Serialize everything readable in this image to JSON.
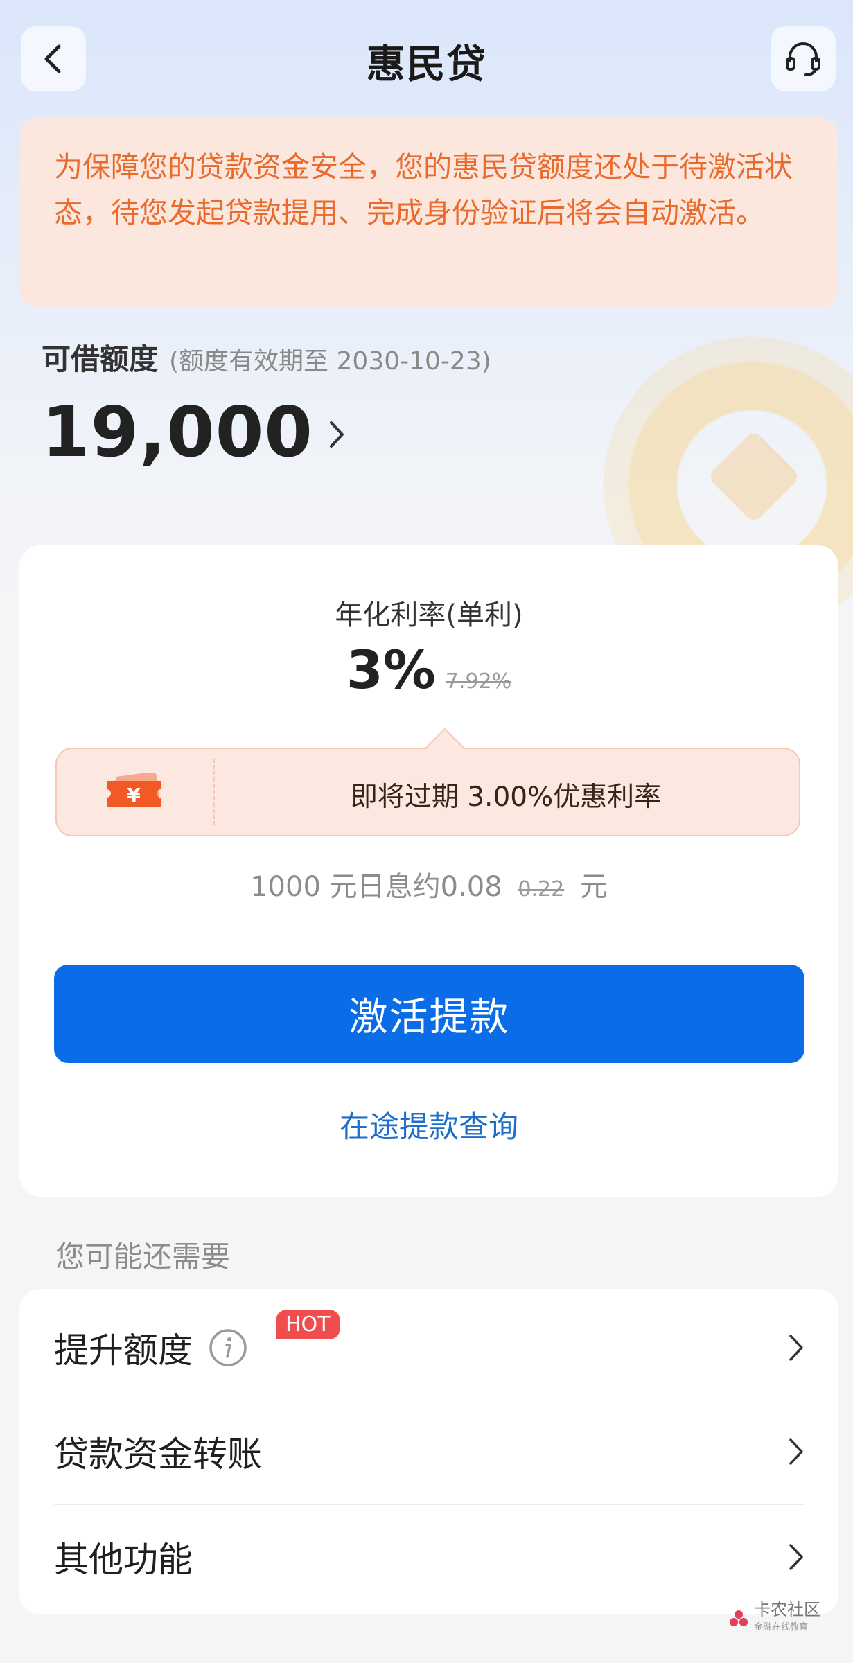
{
  "header": {
    "title": "惠民贷"
  },
  "notice": {
    "text": "为保障您的贷款资金安全，您的惠民贷额度还处于待激活状态，待您发起贷款提用、完成身份验证后将会自动激活。"
  },
  "credit": {
    "label": "可借额度",
    "validity": "(额度有效期至 2030-10-23)",
    "amount": "19,000"
  },
  "rate": {
    "title": "年化利率(单利)",
    "value": "3%",
    "original": "7.92%"
  },
  "coupon": {
    "icon_symbol": "¥",
    "text": "即将过期 3.00%优惠利率"
  },
  "interest": {
    "prefix": "1000 元日息约0.08",
    "original": "0.22",
    "suffix": "元"
  },
  "actions": {
    "primary_label": "激活提款",
    "query_link": "在途提款查询"
  },
  "more": {
    "heading": "您可能还需要",
    "items": [
      {
        "label": "提升额度",
        "badge": "HOT"
      },
      {
        "label": "贷款资金转账"
      },
      {
        "label": "其他功能"
      }
    ]
  },
  "watermark": {
    "name": "卡农社区",
    "sub": "金融在线教育"
  },
  "colors": {
    "primary": "#0a6ce6",
    "notice_text": "#ea6a2c",
    "notice_bg": "#fce7de",
    "hot": "#f04e4e"
  }
}
